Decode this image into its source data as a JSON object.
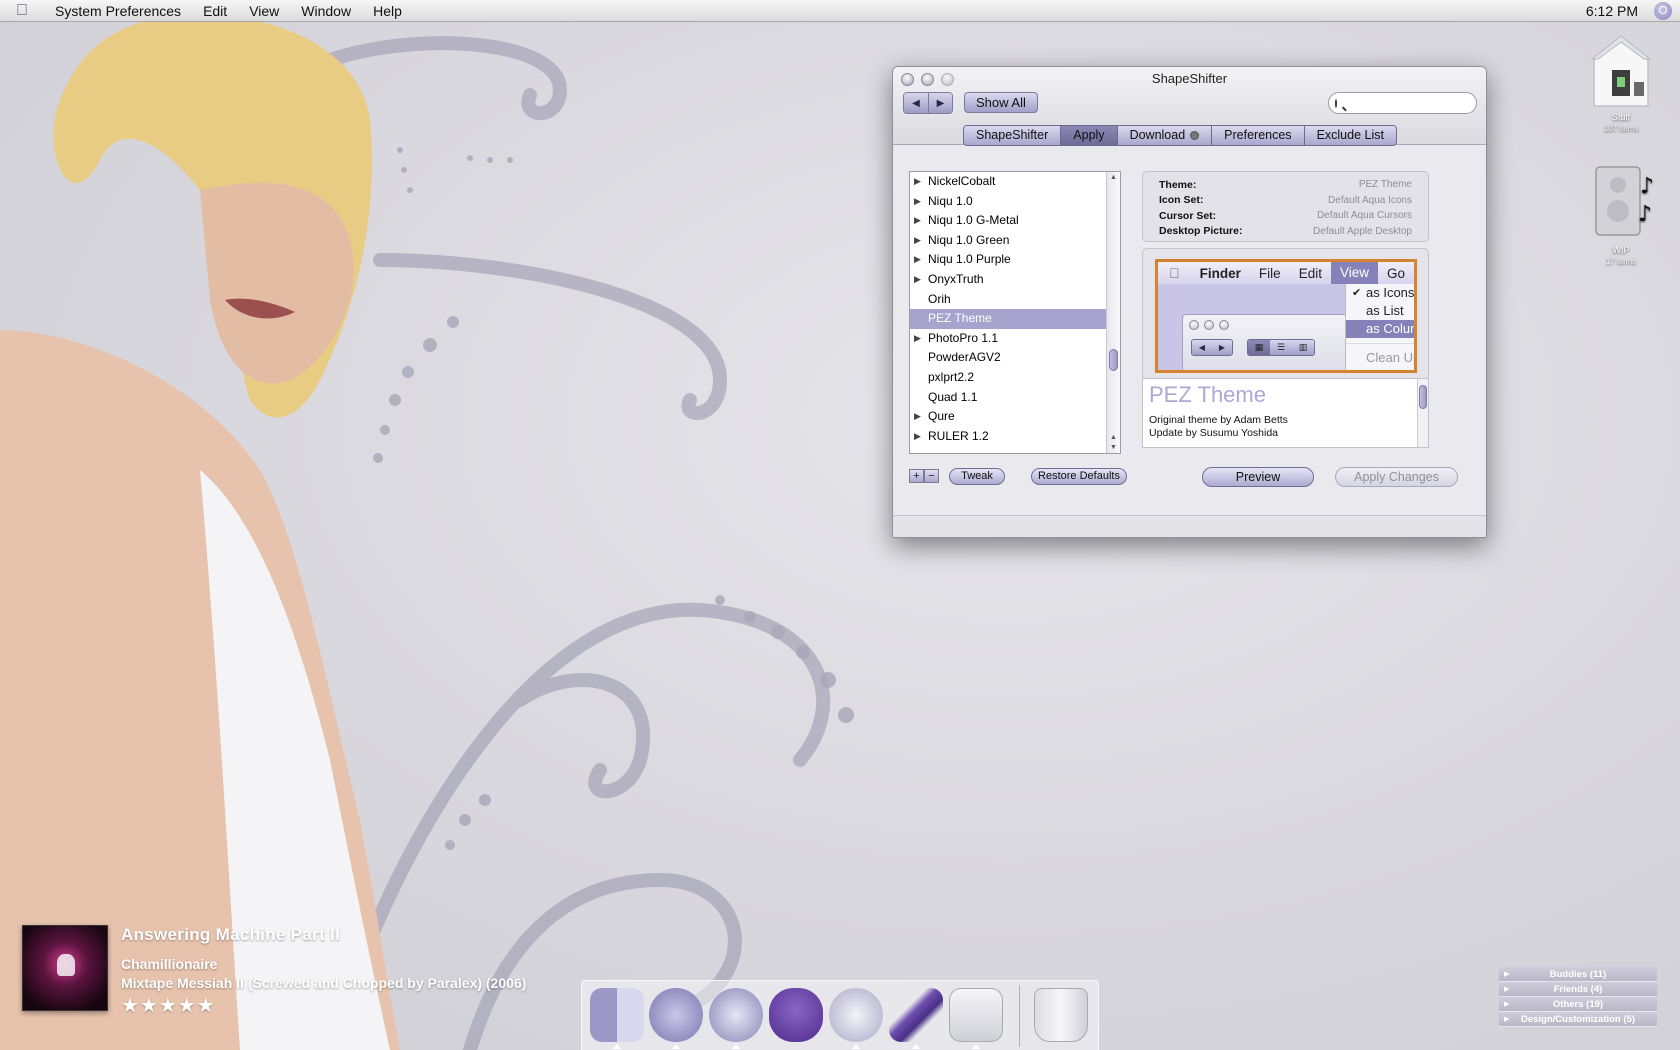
{
  "menubar": {
    "app_name": "System Preferences",
    "menus": [
      "Edit",
      "View",
      "Window",
      "Help"
    ],
    "clock": "6:12 PM"
  },
  "window": {
    "title": "ShapeShifter",
    "show_all": "Show All",
    "search_placeholder": "",
    "tabs": [
      {
        "label": "ShapeShifter",
        "selected": false
      },
      {
        "label": "Apply",
        "selected": true
      },
      {
        "label": "Download",
        "selected": false
      },
      {
        "label": "Preferences",
        "selected": false
      },
      {
        "label": "Exclude List",
        "selected": false
      }
    ],
    "theme_list": [
      {
        "label": "NickelCobalt",
        "expandable": true,
        "selected": false
      },
      {
        "label": "Niqu 1.0",
        "expandable": true,
        "selected": false
      },
      {
        "label": "Niqu 1.0 G-Metal",
        "expandable": true,
        "selected": false
      },
      {
        "label": "Niqu 1.0 Green",
        "expandable": true,
        "selected": false
      },
      {
        "label": "Niqu 1.0 Purple",
        "expandable": true,
        "selected": false
      },
      {
        "label": "OnyxTruth",
        "expandable": true,
        "selected": false
      },
      {
        "label": "Orih",
        "expandable": false,
        "selected": false
      },
      {
        "label": "PEZ Theme",
        "expandable": false,
        "selected": true
      },
      {
        "label": "PhotoPro 1.1",
        "expandable": true,
        "selected": false
      },
      {
        "label": "PowderAGV2",
        "expandable": false,
        "selected": false
      },
      {
        "label": "pxlprt2.2",
        "expandable": false,
        "selected": false
      },
      {
        "label": "Quad 1.1",
        "expandable": false,
        "selected": false
      },
      {
        "label": "Qure",
        "expandable": true,
        "selected": false
      },
      {
        "label": "RULER 1.2",
        "expandable": true,
        "selected": false
      }
    ],
    "add_label": "+",
    "remove_label": "−",
    "tweak_label": "Tweak",
    "restore_label": "Restore Defaults",
    "info": {
      "theme_key": "Theme:",
      "theme_val": "PEZ Theme",
      "iconset_key": "Icon Set:",
      "iconset_val": "Default Aqua Icons",
      "cursor_key": "Cursor Set:",
      "cursor_val": "Default Aqua Cursors",
      "desktop_key": "Desktop Picture:",
      "desktop_val": "Default Apple Desktop"
    },
    "preview_image": {
      "menus": [
        "Finder",
        "File",
        "Edit",
        "View",
        "Go"
      ],
      "dropdown": [
        "as Icons",
        "as List",
        "as Columns",
        "Clean Up"
      ]
    },
    "description": {
      "title": "PEZ Theme",
      "line1": "Original theme by Adam Betts",
      "line2": "Update by Susumu Yoshida"
    },
    "preview_label": "Preview",
    "apply_changes_label": "Apply Changes"
  },
  "desktop_icons": [
    {
      "name": "Stuff",
      "count": "107 items"
    },
    {
      "name": "WIP",
      "count": "17 items"
    }
  ],
  "now_playing": {
    "title": "Answering Machine Part II",
    "artist": "Chamillionaire",
    "album": "Mixtape Messiah II (Screwed and Chopped by Paralex) (2006)",
    "rating": "★★★★★"
  },
  "buddy_list": [
    "Buddies (11)",
    "Friends (4)",
    "Others (19)",
    "Design/Customization (5)"
  ],
  "colors": {
    "accent": "#a7a3cf",
    "preview_border": "#d4832e"
  }
}
